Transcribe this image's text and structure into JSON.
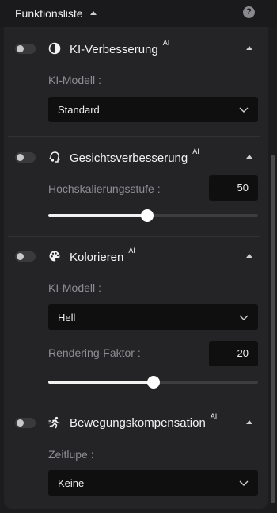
{
  "header": {
    "title": "Funktionsliste",
    "help": "?"
  },
  "sections": [
    {
      "title": "KI-Verbesserung",
      "badge": "AI",
      "icon": "contrast-icon",
      "model_label": "KI-Modell :",
      "model_value": "Standard"
    },
    {
      "title": "Gesichtsverbesserung",
      "badge": "AI",
      "icon": "face-icon",
      "scale_label": "Hochskalierungsstufe :",
      "scale_value": "50",
      "scale_fraction": 0.47
    },
    {
      "title": "Kolorieren",
      "badge": "AI",
      "icon": "palette-icon",
      "model_label": "KI-Modell :",
      "model_value": "Hell",
      "render_label": "Rendering-Faktor :",
      "render_value": "20",
      "render_fraction": 0.5
    },
    {
      "title": "Bewegungskompensation",
      "badge": "AI",
      "icon": "running-icon",
      "slowmo_label": "Zeitlupe :",
      "slowmo_value": "Keine"
    }
  ],
  "colors": {
    "background": "#1c1c1e",
    "panel": "#242426",
    "field": "#0f0f10",
    "accent": "#f2f2f2"
  }
}
